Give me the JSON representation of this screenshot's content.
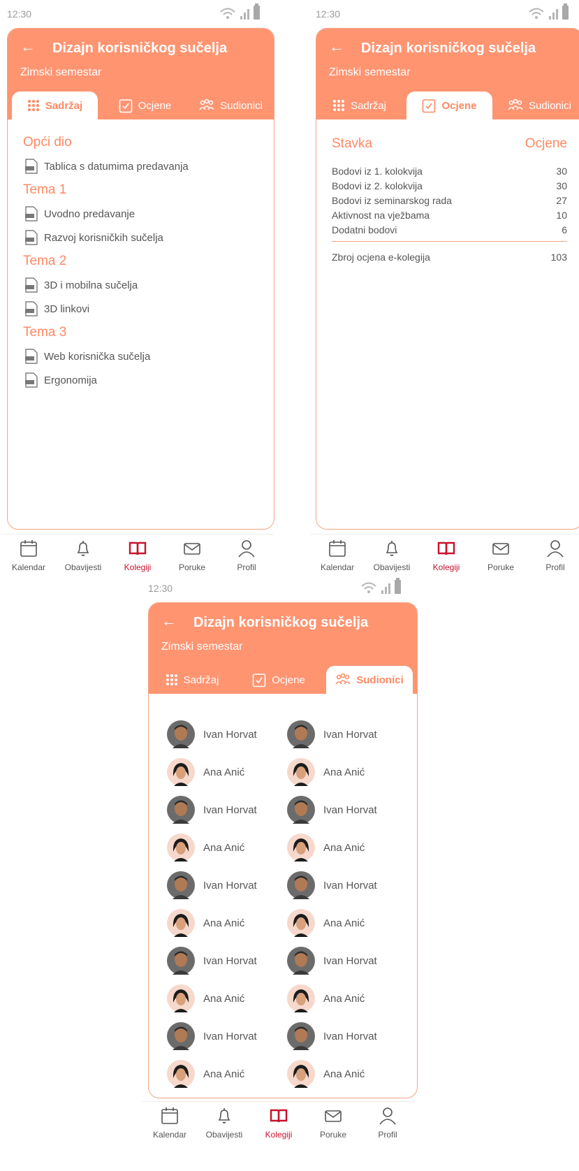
{
  "status": {
    "time": "12:30"
  },
  "course": {
    "title": "Dizajn korisničkog sučelja",
    "subtitle": "Zimski semestar"
  },
  "tabs": {
    "sadrzaj": "Sadržaj",
    "ocjene": "Ocjene",
    "sudionici": "Sudionici"
  },
  "content": {
    "sections": [
      {
        "title": "Opći dio",
        "files": [
          "Tablica s datumima predavanja"
        ]
      },
      {
        "title": "Tema 1",
        "files": [
          "Uvodno predavanje",
          "Razvoj korisničkih sučelja"
        ]
      },
      {
        "title": "Tema 2",
        "files": [
          "3D i mobilna sučelja",
          "3D linkovi"
        ]
      },
      {
        "title": "Tema 3",
        "files": [
          "Web korisnička sučelja",
          "Ergonomija"
        ]
      }
    ]
  },
  "grades": {
    "col_item": "Stavka",
    "col_grade": "Ocjene",
    "rows": [
      {
        "item": "Bodovi iz 1. kolokvija",
        "value": "30"
      },
      {
        "item": "Bodovi iz 2. kolokvija",
        "value": "30"
      },
      {
        "item": "Bodovi iz seminarskog rada",
        "value": "27"
      },
      {
        "item": "Aktivnost na vježbama",
        "value": "10"
      },
      {
        "item": "Dodatni bodovi",
        "value": "6"
      }
    ],
    "total_label": "Zbroj ocjena e-kolegija",
    "total_value": "103"
  },
  "participants": [
    "Ivan Horvat",
    "Ivan Horvat",
    "Ana Anić",
    "Ana Anić",
    "Ivan Horvat",
    "Ivan Horvat",
    "Ana Anić",
    "Ana Anić",
    "Ivan Horvat",
    "Ivan Horvat",
    "Ana Anić",
    "Ana Anić",
    "Ivan Horvat",
    "Ivan Horvat",
    "Ana Anić",
    "Ana Anić",
    "Ivan Horvat",
    "Ivan Horvat",
    "Ana Anić",
    "Ana Anić"
  ],
  "nav": {
    "kalendar": "Kalendar",
    "obavijesti": "Obavijesti",
    "kolegiji": "Kolegiji",
    "poruke": "Poruke",
    "profil": "Profil"
  },
  "colors": {
    "accent": "#ff9471",
    "accent_text": "#ff8862",
    "active_nav": "#c8102e"
  }
}
